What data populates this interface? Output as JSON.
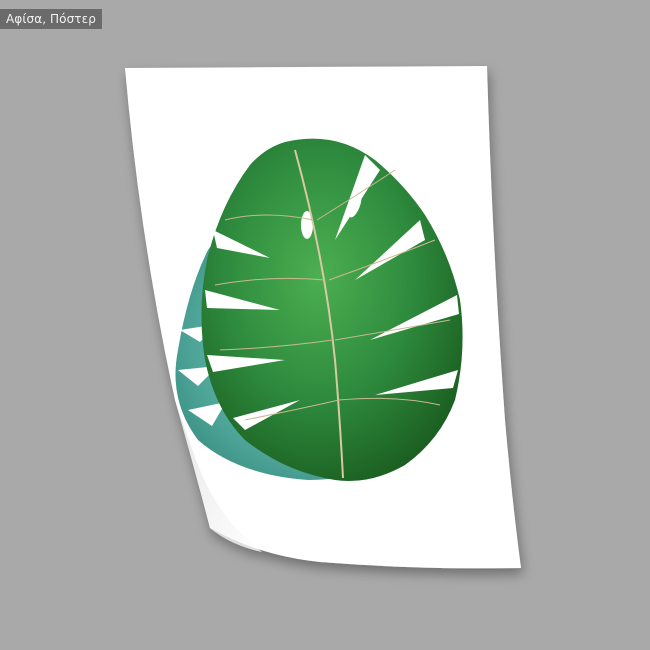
{
  "product_label": "Αφίσα, Πόστερ",
  "colors": {
    "background": "#a9a9a9",
    "tag_background": "#6b6b6b",
    "tag_text": "#f2f2f2",
    "paper": "#ffffff",
    "leaf_front": "#2e8b3e",
    "leaf_front_dark": "#1f6b2c",
    "leaf_back": "#4fa79a",
    "leaf_back_dark": "#2f7f74",
    "vein": "#d8c9a0"
  },
  "icons": {
    "poster": "curled-paper-poster",
    "artwork": "monstera-leaf"
  }
}
